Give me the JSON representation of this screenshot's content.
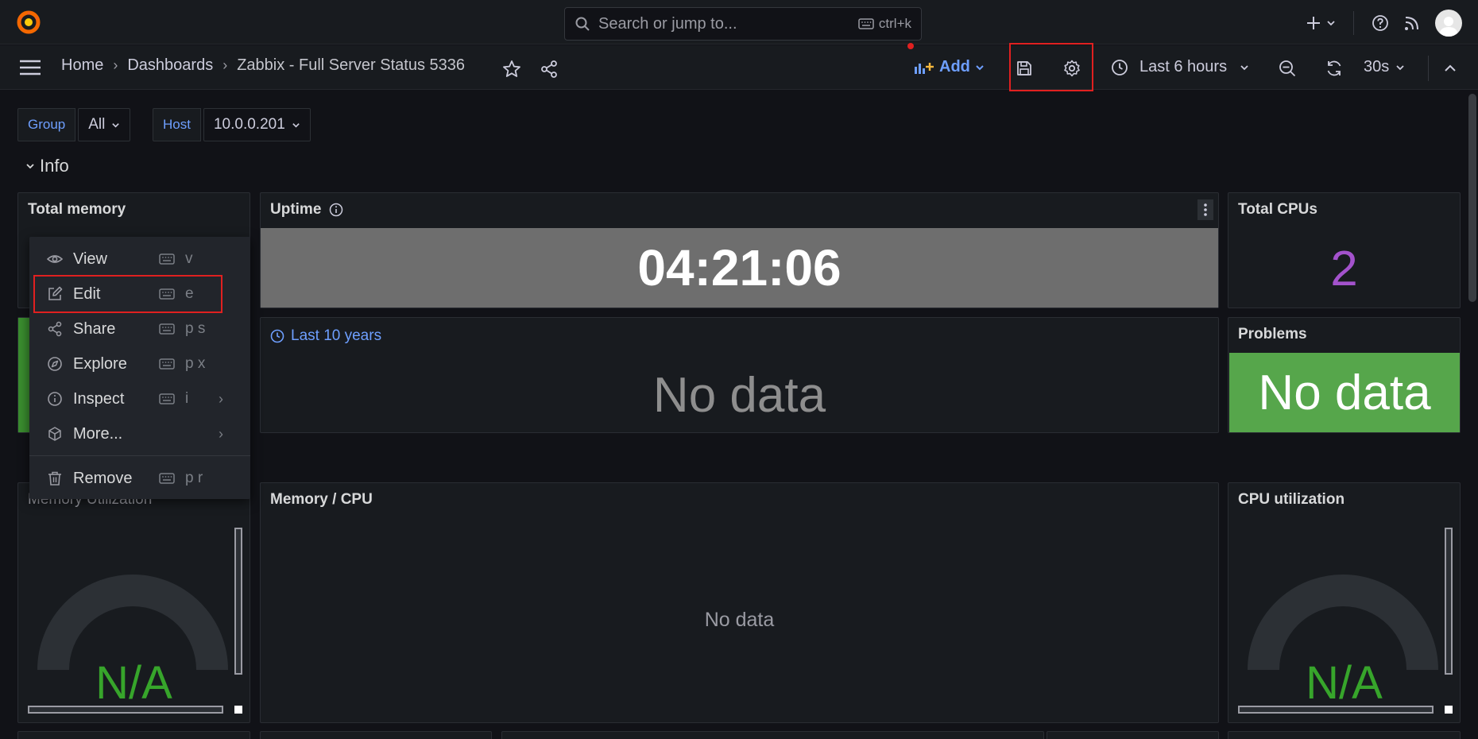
{
  "topbar": {
    "search_placeholder": "Search or jump to...",
    "search_shortcut": "ctrl+k"
  },
  "breadcrumb": {
    "home": "Home",
    "dashboards": "Dashboards",
    "current": "Zabbix - Full Server Status 5336"
  },
  "toolbar": {
    "add_label": "Add",
    "time_range": "Last 6 hours",
    "refresh_interval": "30s"
  },
  "variables": [
    {
      "label": "Group",
      "value": "All"
    },
    {
      "label": "Host",
      "value": "10.0.0.201"
    }
  ],
  "row": {
    "title": "Info"
  },
  "panels": {
    "total_memory": {
      "title": "Total memory"
    },
    "uptime": {
      "title": "Uptime",
      "value": "04:21:06"
    },
    "total_cpus": {
      "title": "Total CPUs",
      "value": "2"
    },
    "last10": {
      "time_override": "Last 10 years",
      "value": "No data"
    },
    "problems": {
      "title": "Problems",
      "value": "No data"
    },
    "memory_util": {
      "title": "Memory Utilization",
      "value": "N/A"
    },
    "memory_cpu": {
      "title": "Memory / CPU",
      "value": "No data"
    },
    "cpu_util": {
      "title": "CPU utilization",
      "value": "N/A"
    }
  },
  "menu": {
    "items": [
      {
        "label": "View",
        "shortcut": "v"
      },
      {
        "label": "Edit",
        "shortcut": "e"
      },
      {
        "label": "Share",
        "shortcut": "p s"
      },
      {
        "label": "Explore",
        "shortcut": "p x"
      },
      {
        "label": "Inspect",
        "shortcut": "i"
      },
      {
        "label": "More..."
      },
      {
        "label": "Remove",
        "shortcut": "p r"
      }
    ]
  },
  "colors": {
    "accent_blue": "#6e9fff",
    "purple_stat": "#a352cc",
    "green": "#37a52b",
    "problems_bg": "#56a64b",
    "highlight_red": "#e02020"
  }
}
